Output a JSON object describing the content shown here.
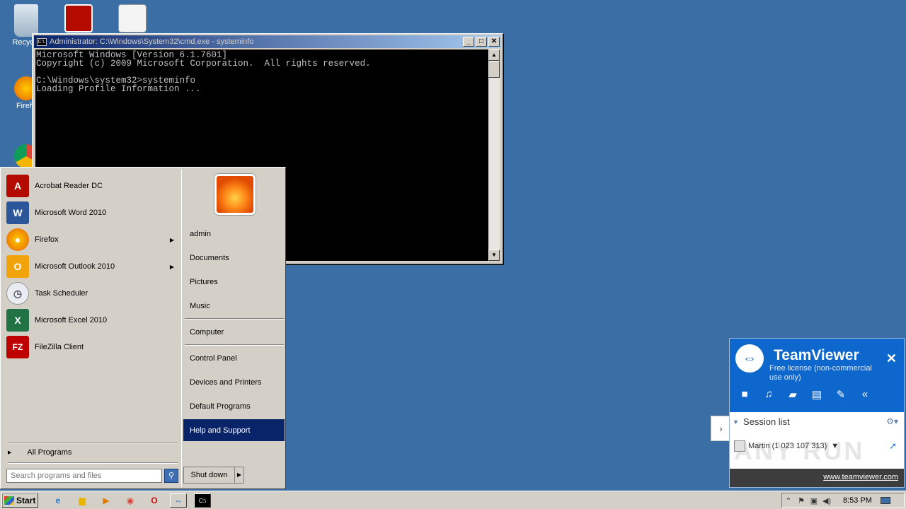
{
  "desktop": {
    "icons": [
      {
        "label": "Recycle",
        "icon": "recycle-bin-icon"
      },
      {
        "label": "Firefo",
        "icon": "firefox-icon"
      }
    ]
  },
  "cmd": {
    "title": "Administrator: C:\\Windows\\System32\\cmd.exe - systeminfo",
    "icon": "C:\\.",
    "minimize": "_",
    "maximize": "□",
    "close": "✕",
    "lines": [
      "Microsoft Windows [Version 6.1.7601]",
      "Copyright (c) 2009 Microsoft Corporation.  All rights reserved.",
      "",
      "C:\\Windows\\system32>systeminfo",
      "Loading Profile Information ..."
    ]
  },
  "start_menu": {
    "programs": [
      {
        "label": "Acrobat Reader DC",
        "icon": "acrobat-icon",
        "color": "#b30b00",
        "glyph": "A"
      },
      {
        "label": "Microsoft Word 2010",
        "icon": "word-icon",
        "color": "#2b579a",
        "glyph": "W"
      },
      {
        "label": "Firefox",
        "icon": "firefox-icon",
        "color": "#e66000",
        "glyph": "●",
        "arrow": "▶"
      },
      {
        "label": "Microsoft Outlook 2010",
        "icon": "outlook-icon",
        "color": "#f0a30a",
        "glyph": "O",
        "arrow": "▶"
      },
      {
        "label": "Task Scheduler",
        "icon": "clock-icon",
        "color": "#9aa7b8",
        "glyph": "◷"
      },
      {
        "label": "Microsoft Excel 2010",
        "icon": "excel-icon",
        "color": "#217346",
        "glyph": "X"
      },
      {
        "label": "FileZilla Client",
        "icon": "filezilla-icon",
        "color": "#bf0000",
        "glyph": "FZ"
      }
    ],
    "all_programs": "All Programs",
    "search_placeholder": "Search programs and files",
    "right_items": [
      "admin",
      "Documents",
      "Pictures",
      "Music",
      "Computer",
      "Control Panel",
      "Devices and Printers",
      "Default Programs",
      "Help and Support"
    ],
    "shutdown_label": "Shut down",
    "shutdown_arrow": "▶"
  },
  "teamviewer": {
    "name": "TeamViewer",
    "license": "Free license (non-commercial use only)",
    "close": "✕",
    "session_list": "Session list",
    "contact": "Martin (1 023 107 313)",
    "watermark": "ANY RUN",
    "link": "www.teamviewer.com",
    "tab_arrow": "›"
  },
  "taskbar": {
    "start_label": "Start",
    "clock": "8:53 PM"
  }
}
